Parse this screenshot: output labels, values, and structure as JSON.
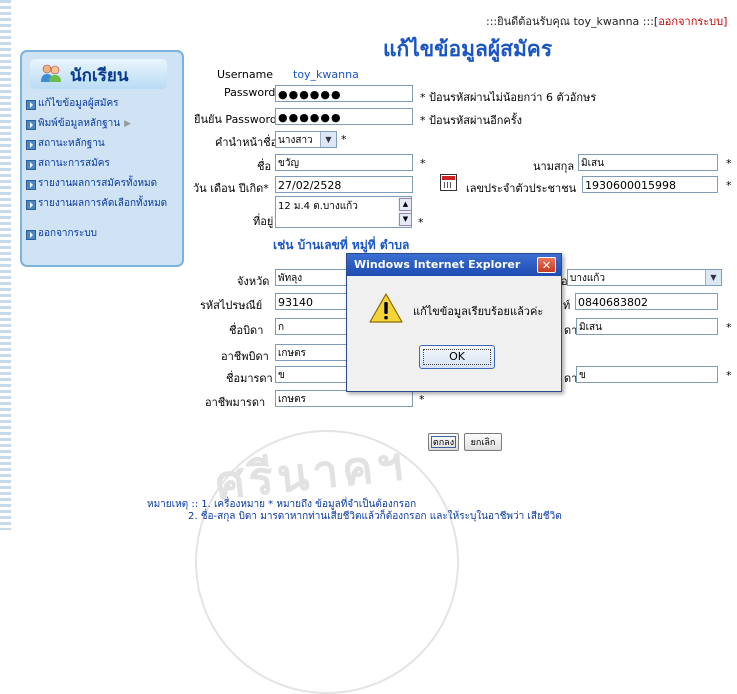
{
  "header": {
    "welcome_prefix": ":::ยินดีต้อนรับคุณ toy_kwanna :::[",
    "logout_link": "ออกจากระบบ]",
    "page_title": "แก้ไขข้อมูลผู้สมัคร"
  },
  "sidebar": {
    "title": "นักเรียน",
    "icon": "students-icon",
    "items": [
      {
        "label": "แก้ไขข้อมูลผู้สมัคร"
      },
      {
        "label": "พิมพ์ข้อมูลหลักฐาน",
        "arrow": "▶"
      },
      {
        "label": "สถานะหลักฐาน"
      },
      {
        "label": "สถานะการสมัคร"
      },
      {
        "label": "รายงานผลการสมัครทั้งหมด"
      },
      {
        "label": "รายงานผลการคัดเลือกทั้งหมด"
      },
      {
        "label": "ออกจากระบบ"
      }
    ]
  },
  "form": {
    "username_label": "Username",
    "username_value": "toy_kwanna",
    "password_label": "Password",
    "password_value": "●●●●●●",
    "password_note": "* ป้อนรหัสผ่านไม่น้อยกว่า 6 ตัวอักษร",
    "confirm_label": "ยืนยัน Password",
    "confirm_value": "●●●●●●",
    "confirm_note": "* ป้อนรหัสผ่านอีกครั้ง",
    "prefix_label": "คำนำหน้าชื่อ",
    "prefix_value": "นางสาว",
    "firstname_label": "ชื่อ",
    "firstname_value": "ขวัญ",
    "lastname_label": "นามสกุล",
    "lastname_value": "มิเสน",
    "birthdate_label": "วัน เดือน ปีเกิด*",
    "birthdate_value": "27/02/2528",
    "idcard_label": "เลขประจำตัวประชาชน",
    "idcard_value": "1930600015998",
    "address_label": "ที่อยู่",
    "address_value": "12 ม.4 ต.บางแก้ว",
    "address_example": "เช่น บ้านเลขที่ หมู่ที่ ตำบล",
    "province_label": "จังหวัด",
    "province_value": "พัทลุง",
    "district_label_partial": "อ",
    "district_value": "บางแก้ว",
    "postcode_label": "รหัสไปรษณีย์",
    "postcode_value": "93140",
    "phone_label_partial": "ท์",
    "phone_value": "0840683802",
    "father_label": "ชื่อบิดา",
    "father_value": "ก",
    "father_lastname_partial": "ดา",
    "father_lastname_value": "มิเสน",
    "father_job_label": "อาชีพบิดา",
    "father_job_value": "เกษตร",
    "mother_label": "ชื่อมารดา",
    "mother_value": "ข",
    "mother_lastname_partial": "ดา",
    "mother_lastname_value": "ข",
    "mother_job_label": "อาชีพมารดา",
    "mother_job_value": "เกษตร",
    "star": "*",
    "submit_label": "ตกลง",
    "cancel_label": "ยกเลิก"
  },
  "remarks": {
    "line1": "หมายเหตุ :: 1. เครื่องหมาย * หมายถึง ข้อมูลที่จำเป็นต้องกรอก",
    "line2": "2. ชื่อ-สกุล บิดา มารดาหากท่านเสียชีวิตแล้วก็ต้องกรอก และให้ระบุในอาชีพว่า เสียชีวิต"
  },
  "watermark": "ศรีนาคฯ",
  "dialog": {
    "title": "Windows Internet Explorer",
    "close": "✕",
    "message": "แก้ไขข้อมูลเรียบร้อยแล้วค่ะ",
    "ok_label": "OK",
    "icon": "warning-icon"
  }
}
